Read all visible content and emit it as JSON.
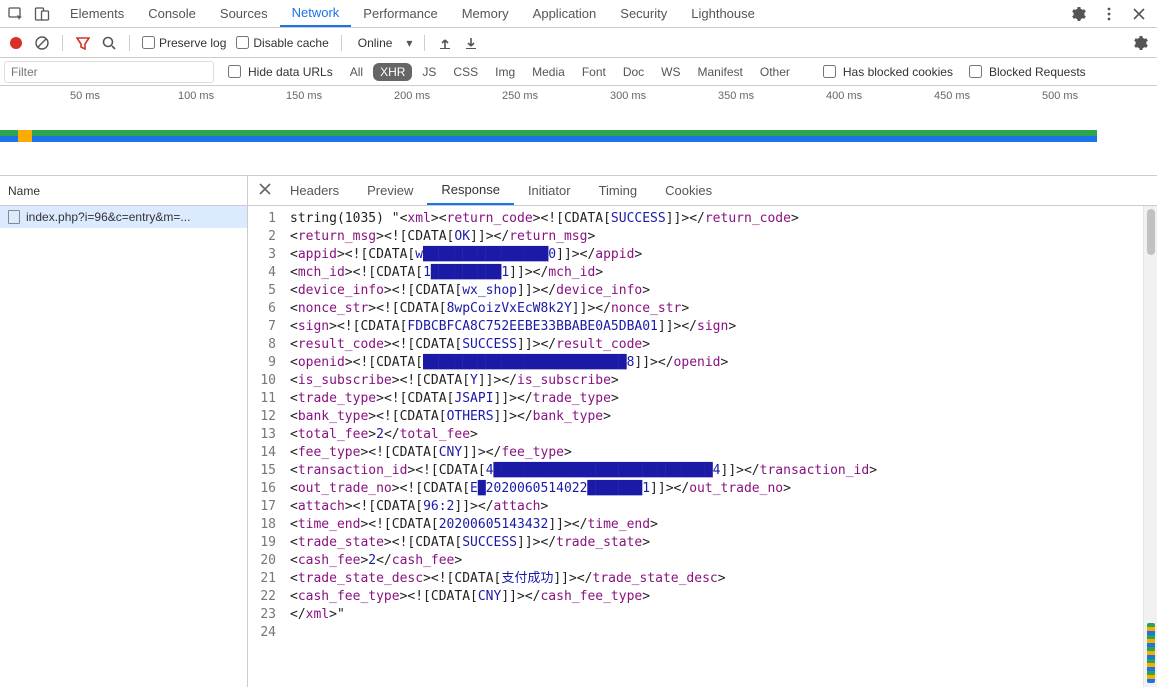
{
  "topTabs": {
    "items": [
      "Elements",
      "Console",
      "Sources",
      "Network",
      "Performance",
      "Memory",
      "Application",
      "Security",
      "Lighthouse"
    ],
    "active": "Network"
  },
  "toolbar": {
    "preserveLog": "Preserve log",
    "disableCache": "Disable cache",
    "throttling": "Online"
  },
  "filterBar": {
    "placeholder": "Filter",
    "hideDataUrls": "Hide data URLs",
    "types": [
      "All",
      "XHR",
      "JS",
      "CSS",
      "Img",
      "Media",
      "Font",
      "Doc",
      "WS",
      "Manifest",
      "Other"
    ],
    "activeType": "XHR",
    "hasBlockedCookies": "Has blocked cookies",
    "blockedRequests": "Blocked Requests"
  },
  "timeline": {
    "ticks": [
      "50 ms",
      "100 ms",
      "150 ms",
      "200 ms",
      "250 ms",
      "300 ms",
      "350 ms",
      "400 ms",
      "450 ms",
      "500 ms"
    ]
  },
  "requestList": {
    "header": "Name",
    "rows": [
      "index.php?i=96&c=entry&m=..."
    ]
  },
  "detailTabs": {
    "items": [
      "Headers",
      "Preview",
      "Response",
      "Initiator",
      "Timing",
      "Cookies"
    ],
    "active": "Response"
  },
  "response": {
    "prefix": "string(1035) \"",
    "suffix": "\"",
    "fields": [
      {
        "tag": "return_code",
        "cdata": "SUCCESS"
      },
      {
        "tag": "return_msg",
        "cdata": "OK"
      },
      {
        "tag": "appid",
        "cdata": "w████████████████0"
      },
      {
        "tag": "mch_id",
        "cdata": "1█████████1"
      },
      {
        "tag": "device_info",
        "cdata": "wx_shop"
      },
      {
        "tag": "nonce_str",
        "cdata": "8wpCoizVxEcW8k2Y"
      },
      {
        "tag": "sign",
        "cdata": "FDBCBFCA8C752EEBE33BBABE0A5DBA01"
      },
      {
        "tag": "result_code",
        "cdata": "SUCCESS"
      },
      {
        "tag": "openid",
        "cdata": "██████████████████████████8"
      },
      {
        "tag": "is_subscribe",
        "cdata": "Y"
      },
      {
        "tag": "trade_type",
        "cdata": "JSAPI"
      },
      {
        "tag": "bank_type",
        "cdata": "OTHERS"
      },
      {
        "tag": "total_fee",
        "text": "2"
      },
      {
        "tag": "fee_type",
        "cdata": "CNY"
      },
      {
        "tag": "transaction_id",
        "cdata": "4████████████████████████████4"
      },
      {
        "tag": "out_trade_no",
        "cdata": "E█2020060514022███████1"
      },
      {
        "tag": "attach",
        "cdata": "96:2"
      },
      {
        "tag": "time_end",
        "cdata": "20200605143432"
      },
      {
        "tag": "trade_state",
        "cdata": "SUCCESS"
      },
      {
        "tag": "cash_fee",
        "text": "2"
      },
      {
        "tag": "trade_state_desc",
        "cdata": "支付成功"
      },
      {
        "tag": "cash_fee_type",
        "cdata": "CNY"
      }
    ]
  }
}
